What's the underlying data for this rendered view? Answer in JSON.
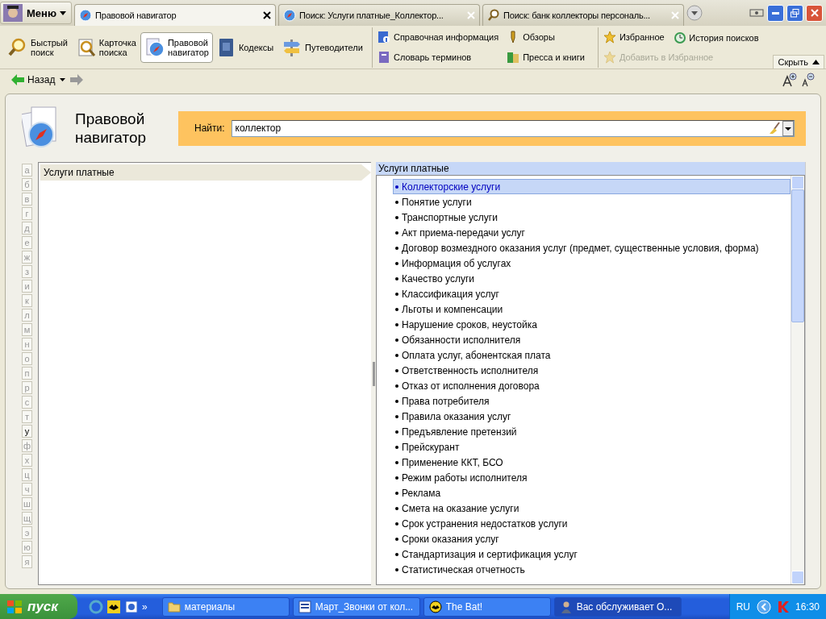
{
  "menu_button": {
    "label": "Меню"
  },
  "tabs": [
    {
      "label": "Правовой навигатор",
      "selected": true,
      "kind": "navigator"
    },
    {
      "label": "Поиск: Услуги платные_Коллектор...",
      "selected": false,
      "kind": "navigator"
    },
    {
      "label": "Поиск: банк коллекторы персональ...",
      "selected": false,
      "kind": "search"
    }
  ],
  "toolbar": {
    "big_buttons": [
      {
        "lines": [
          "Быстрый",
          "поиск"
        ],
        "kind": "search",
        "selected": false
      },
      {
        "lines": [
          "Карточка",
          "поиска"
        ],
        "kind": "card",
        "selected": false
      },
      {
        "lines": [
          "Правовой",
          "навигатор"
        ],
        "kind": "compass",
        "selected": true
      },
      {
        "lines": [
          "Кодексы"
        ],
        "kind": "book",
        "selected": false
      },
      {
        "lines": [
          "Путеводители"
        ],
        "kind": "signpost",
        "selected": false
      }
    ],
    "link_columns": [
      [
        {
          "label": "Справочная информация",
          "kind": "info",
          "disabled": false
        },
        {
          "label": "Словарь терминов",
          "kind": "dict",
          "disabled": false
        }
      ],
      [
        {
          "label": "Обзоры",
          "kind": "pen",
          "disabled": false
        },
        {
          "label": "Пресса и книги",
          "kind": "press",
          "disabled": false
        }
      ],
      [
        {
          "label": "Избранное",
          "kind": "star",
          "disabled": false
        },
        {
          "label": "Добавить в Избранное",
          "kind": "star",
          "disabled": true
        }
      ],
      [
        {
          "label": "История поисков",
          "kind": "history",
          "disabled": false
        }
      ]
    ],
    "hide_button": "Скрыть"
  },
  "nav": {
    "back": "Назад"
  },
  "navigator": {
    "title_lines": [
      "Правовой",
      "навигатор"
    ],
    "search": {
      "label": "Найти:",
      "value": "коллектор"
    },
    "alphabet": [
      {
        "letter": "а",
        "selected": false
      },
      {
        "letter": "б",
        "selected": false
      },
      {
        "letter": "в",
        "selected": false
      },
      {
        "letter": "г",
        "selected": false
      },
      {
        "letter": "д",
        "selected": false
      },
      {
        "letter": "е",
        "selected": false
      },
      {
        "letter": "ж",
        "selected": false
      },
      {
        "letter": "з",
        "selected": false
      },
      {
        "letter": "и",
        "selected": false
      },
      {
        "letter": "к",
        "selected": false
      },
      {
        "letter": "л",
        "selected": false
      },
      {
        "letter": "м",
        "selected": false
      },
      {
        "letter": "н",
        "selected": false
      },
      {
        "letter": "о",
        "selected": false
      },
      {
        "letter": "п",
        "selected": false
      },
      {
        "letter": "р",
        "selected": false
      },
      {
        "letter": "с",
        "selected": false
      },
      {
        "letter": "т",
        "selected": false
      },
      {
        "letter": "у",
        "selected": true
      },
      {
        "letter": "ф",
        "selected": false
      },
      {
        "letter": "х",
        "selected": false
      },
      {
        "letter": "ц",
        "selected": false
      },
      {
        "letter": "ч",
        "selected": false
      },
      {
        "letter": "ш",
        "selected": false
      },
      {
        "letter": "щ",
        "selected": false
      },
      {
        "letter": "э",
        "selected": false
      },
      {
        "letter": "ю",
        "selected": false
      },
      {
        "letter": "я",
        "selected": false
      }
    ],
    "left_items": [
      {
        "label": "Услуги платные",
        "selected": true
      }
    ],
    "right_header": "Услуги платные",
    "topics": [
      {
        "label": "Коллекторские услуги",
        "selected": true
      },
      {
        "label": "Понятие услуги",
        "selected": false
      },
      {
        "label": "Транспортные услуги",
        "selected": false
      },
      {
        "label": "Акт приема-передачи услуг",
        "selected": false
      },
      {
        "label": "Договор возмездного оказания услуг (предмет, существенные условия, форма)",
        "selected": false
      },
      {
        "label": "Информация об услугах",
        "selected": false
      },
      {
        "label": "Качество услуги",
        "selected": false
      },
      {
        "label": "Классификация услуг",
        "selected": false
      },
      {
        "label": "Льготы и компенсации",
        "selected": false
      },
      {
        "label": "Нарушение сроков, неустойка",
        "selected": false
      },
      {
        "label": "Обязанности исполнителя",
        "selected": false
      },
      {
        "label": "Оплата услуг, абонентская плата",
        "selected": false
      },
      {
        "label": "Ответственность исполнителя",
        "selected": false
      },
      {
        "label": "Отказ от исполнения договора",
        "selected": false
      },
      {
        "label": "Права потребителя",
        "selected": false
      },
      {
        "label": "Правила оказания услуг",
        "selected": false
      },
      {
        "label": "Предъявление претензий",
        "selected": false
      },
      {
        "label": "Прейскурант",
        "selected": false
      },
      {
        "label": "Применение ККТ, БСО",
        "selected": false
      },
      {
        "label": "Режим работы исполнителя",
        "selected": false
      },
      {
        "label": "Реклама",
        "selected": false
      },
      {
        "label": "Смета на оказание услуги",
        "selected": false
      },
      {
        "label": "Срок устранения недостатков услуги",
        "selected": false
      },
      {
        "label": "Сроки оказания услуг",
        "selected": false
      },
      {
        "label": "Стандартизация и сертификация услуг",
        "selected": false
      },
      {
        "label": "Статистическая отчетность",
        "selected": false
      }
    ]
  },
  "taskbar": {
    "start": "пуск",
    "chevron": "»",
    "tasks": [
      {
        "label": "материалы",
        "kind": "folder",
        "selected": false
      },
      {
        "label": "Март_Звонки от кол...",
        "kind": "doc",
        "selected": false
      },
      {
        "label": "The Bat!",
        "kind": "bat",
        "selected": false
      },
      {
        "label": "Вас обслуживает О...",
        "kind": "person",
        "selected": true
      }
    ],
    "lang": "RU",
    "clock": "16:30"
  }
}
